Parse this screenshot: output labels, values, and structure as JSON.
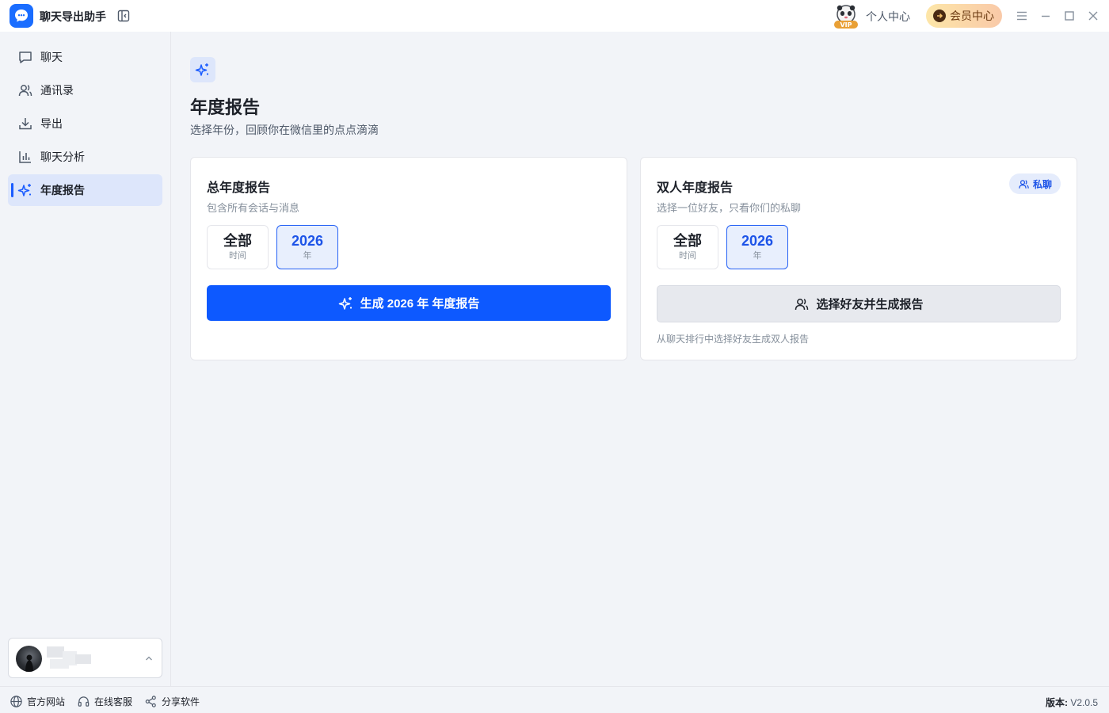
{
  "app": {
    "title": "聊天导出助手"
  },
  "titlebar": {
    "vip_badge": "VIP",
    "personal_center": "个人中心",
    "member_center": "会员中心"
  },
  "sidebar": {
    "items": [
      {
        "label": "聊天",
        "icon": "chat-bubble-icon"
      },
      {
        "label": "通讯录",
        "icon": "contacts-icon"
      },
      {
        "label": "导出",
        "icon": "download-icon"
      },
      {
        "label": "聊天分析",
        "icon": "bar-chart-icon"
      },
      {
        "label": "年度报告",
        "icon": "sparkles-icon",
        "active": true
      }
    ]
  },
  "main": {
    "title": "年度报告",
    "subtitle": "选择年份，回顾你在微信里的点点滴滴",
    "total_card": {
      "title": "总年度报告",
      "desc": "包含所有会话与消息",
      "options": [
        {
          "big": "全部",
          "small": "时间"
        },
        {
          "big": "2026",
          "small": "年",
          "selected": true
        }
      ],
      "button": "生成 2026 年 年度报告"
    },
    "dual_card": {
      "title": "双人年度报告",
      "badge": "私聊",
      "desc": "选择一位好友，只看你们的私聊",
      "options": [
        {
          "big": "全部",
          "small": "时间"
        },
        {
          "big": "2026",
          "small": "年",
          "selected": true
        }
      ],
      "button": "选择好友并生成报告",
      "hint": "从聊天排行中选择好友生成双人报告"
    }
  },
  "statusbar": {
    "website": "官方网站",
    "support": "在线客服",
    "share": "分享软件",
    "version_label": "版本:",
    "version_value": "V2.0.5"
  },
  "colors": {
    "primary": "#0d59ff",
    "active_bg": "#dde6fb",
    "member_gradient_start": "#fde6a8",
    "member_gradient_end": "#f9c9a8"
  }
}
